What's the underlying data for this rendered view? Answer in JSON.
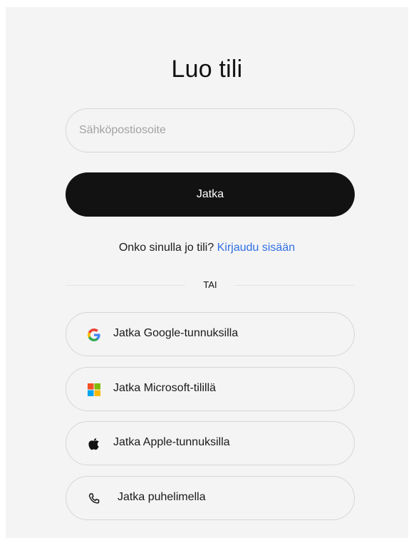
{
  "title": "Luo tili",
  "email": {
    "placeholder": "Sähköpostiosoite",
    "value": ""
  },
  "continue_button": "Jatka",
  "login_prompt": {
    "text": "Onko sinulla jo tili?",
    "link": "Kirjaudu sisään"
  },
  "divider": "TAI",
  "providers": [
    {
      "label": "Jatka Google-tunnuksilla",
      "icon": "google-icon"
    },
    {
      "label": "Jatka Microsoft-tilillä",
      "icon": "microsoft-icon"
    },
    {
      "label": "Jatka Apple-tunnuksilla",
      "icon": "apple-icon"
    },
    {
      "label": "Jatka puhelimella",
      "icon": "phone-icon"
    }
  ],
  "colors": {
    "background": "#f4f4f4",
    "primary_button": "#121212",
    "link": "#2f6fe4"
  }
}
